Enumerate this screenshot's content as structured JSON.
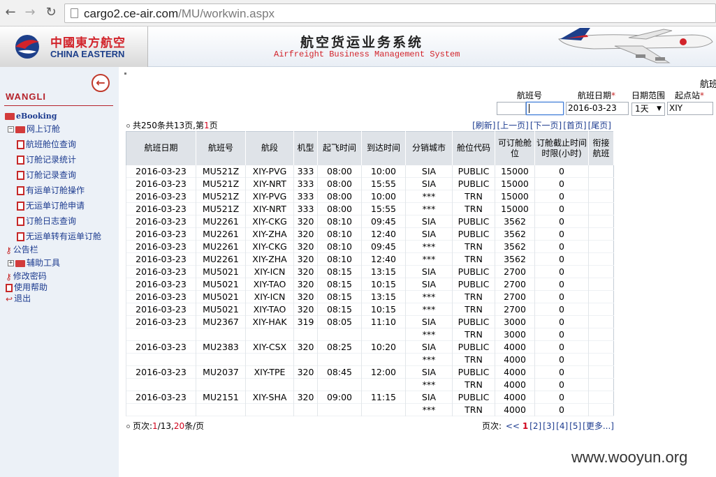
{
  "browser": {
    "url_host": "cargo2.ce-air.com",
    "url_path": "/MU/workwin.aspx"
  },
  "header": {
    "logo_cn": "中國東方航空",
    "logo_en": "CHINA EASTERN",
    "system_cn": "航空货运业务系统",
    "system_en": "Airfreight Business Management System"
  },
  "sidebar": {
    "collapse_icon": "back-arrow-icon",
    "username": "WANGLI",
    "ebooking": "eBooking",
    "online_booking": "网上订舱",
    "sub_items": [
      "航班舱位查询",
      "订舱记录统计",
      "订舱记录查询",
      "有运单订舱操作",
      "无运单订舱申请",
      "订舱日志查询",
      "无运单转有运单订舱"
    ],
    "notice": "公告栏",
    "tools": "辅助工具",
    "change_password": "修改密码",
    "help": "使用帮助",
    "logout": "退出"
  },
  "search": {
    "title_partial": "航班",
    "flight_no_label": "航班号",
    "flight_date_label": "航班日期",
    "date_range_label": "日期范围",
    "origin_label": "起点站",
    "required_mark": "*",
    "flight_no_value": "",
    "flight_date_value": "2016-03-23",
    "date_range_value": "1天",
    "origin_value": "XIY"
  },
  "summary": {
    "prefix": "共250条共13页,第",
    "page": "1",
    "suffix": "页"
  },
  "top_links": [
    "[刷新]",
    "[上一页]",
    "[下一页]",
    "[首页]",
    "[尾页]"
  ],
  "table": {
    "headers": [
      "航班日期",
      "航班号",
      "航段",
      "机型",
      "起飞时间",
      "到达时间",
      "分销城市",
      "舱位代码",
      "可订舱舱位",
      "订舱截止时间时限(小时)",
      "衔接航班"
    ],
    "rows": [
      [
        "2016-03-23",
        "MU521Z",
        "XIY-PVG",
        "333",
        "08:00",
        "10:00",
        "SIA",
        "PUBLIC",
        "15000",
        "0",
        ""
      ],
      [
        "2016-03-23",
        "MU521Z",
        "XIY-NRT",
        "333",
        "08:00",
        "15:55",
        "SIA",
        "PUBLIC",
        "15000",
        "0",
        ""
      ],
      [
        "2016-03-23",
        "MU521Z",
        "XIY-PVG",
        "333",
        "08:00",
        "10:00",
        "***",
        "TRN",
        "15000",
        "0",
        ""
      ],
      [
        "2016-03-23",
        "MU521Z",
        "XIY-NRT",
        "333",
        "08:00",
        "15:55",
        "***",
        "TRN",
        "15000",
        "0",
        ""
      ],
      [
        "2016-03-23",
        "MU2261",
        "XIY-CKG",
        "320",
        "08:10",
        "09:45",
        "SIA",
        "PUBLIC",
        "3562",
        "0",
        ""
      ],
      [
        "2016-03-23",
        "MU2261",
        "XIY-ZHA",
        "320",
        "08:10",
        "12:40",
        "SIA",
        "PUBLIC",
        "3562",
        "0",
        ""
      ],
      [
        "2016-03-23",
        "MU2261",
        "XIY-CKG",
        "320",
        "08:10",
        "09:45",
        "***",
        "TRN",
        "3562",
        "0",
        ""
      ],
      [
        "2016-03-23",
        "MU2261",
        "XIY-ZHA",
        "320",
        "08:10",
        "12:40",
        "***",
        "TRN",
        "3562",
        "0",
        ""
      ],
      [
        "2016-03-23",
        "MU5021",
        "XIY-ICN",
        "320",
        "08:15",
        "13:15",
        "SIA",
        "PUBLIC",
        "2700",
        "0",
        ""
      ],
      [
        "2016-03-23",
        "MU5021",
        "XIY-TAO",
        "320",
        "08:15",
        "10:15",
        "SIA",
        "PUBLIC",
        "2700",
        "0",
        ""
      ],
      [
        "2016-03-23",
        "MU5021",
        "XIY-ICN",
        "320",
        "08:15",
        "13:15",
        "***",
        "TRN",
        "2700",
        "0",
        ""
      ],
      [
        "2016-03-23",
        "MU5021",
        "XIY-TAO",
        "320",
        "08:15",
        "10:15",
        "***",
        "TRN",
        "2700",
        "0",
        ""
      ],
      [
        "2016-03-23",
        "MU2367",
        "XIY-HAK",
        "319",
        "08:05",
        "11:10",
        "SIA",
        "PUBLIC",
        "3000",
        "0",
        ""
      ],
      [
        "",
        "",
        "",
        "",
        "",
        "",
        "***",
        "TRN",
        "3000",
        "0",
        ""
      ],
      [
        "2016-03-23",
        "MU2383",
        "XIY-CSX",
        "320",
        "08:25",
        "10:20",
        "SIA",
        "PUBLIC",
        "4000",
        "0",
        ""
      ],
      [
        "",
        "",
        "",
        "",
        "",
        "",
        "***",
        "TRN",
        "4000",
        "0",
        ""
      ],
      [
        "2016-03-23",
        "MU2037",
        "XIY-TPE",
        "320",
        "08:45",
        "12:00",
        "SIA",
        "PUBLIC",
        "4000",
        "0",
        ""
      ],
      [
        "",
        "",
        "",
        "",
        "",
        "",
        "***",
        "TRN",
        "4000",
        "0",
        ""
      ],
      [
        "2016-03-23",
        "MU2151",
        "XIY-SHA",
        "320",
        "09:00",
        "11:15",
        "SIA",
        "PUBLIC",
        "4000",
        "0",
        ""
      ],
      [
        "",
        "",
        "",
        "",
        "",
        "",
        "***",
        "TRN",
        "4000",
        "0",
        ""
      ]
    ]
  },
  "bottom": {
    "label": "页次:",
    "page": "1",
    "sep": "/13,",
    "per_page": "20",
    "suffix": "条/页"
  },
  "pager": {
    "label": "页次:",
    "prev": "<<",
    "current": "1",
    "pages": [
      "[2]",
      "[3]",
      "[4]",
      "[5]",
      "[更多...]"
    ]
  },
  "watermark": "www.wooyun.org",
  "colors": {
    "brand_red": "#d2232a",
    "brand_blue": "#1d3f8a",
    "link_blue": "#1c3b8f",
    "highlight_red": "#d0021b"
  }
}
